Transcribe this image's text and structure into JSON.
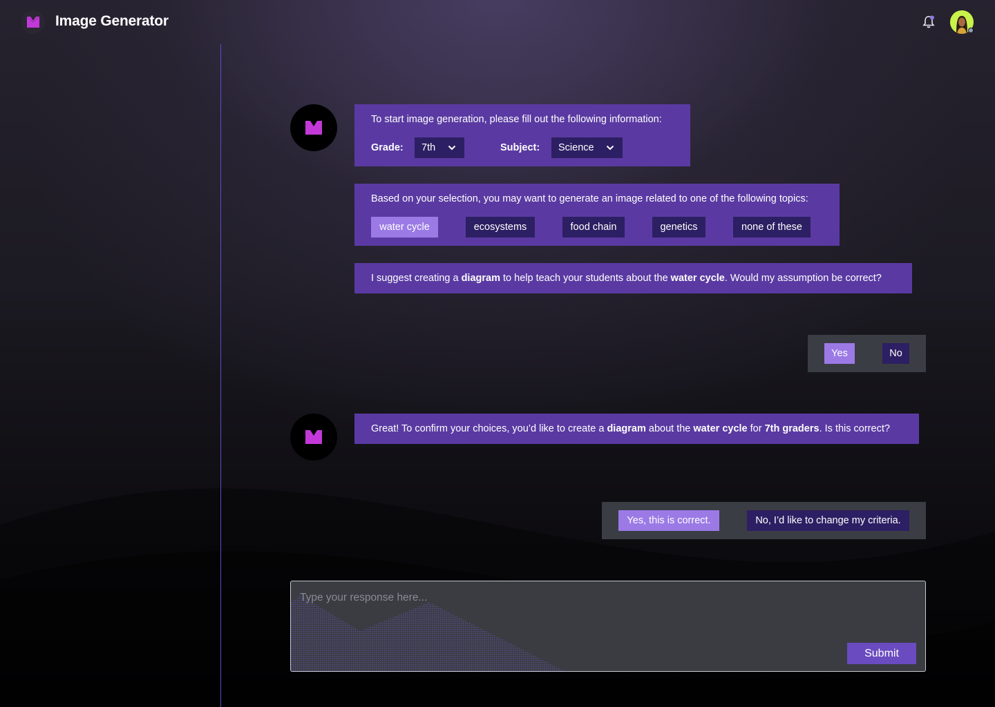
{
  "header": {
    "app_title": "Image Generator",
    "logo_icon": "m-logo-icon",
    "notification_icon": "bell-icon",
    "avatar": "user-avatar"
  },
  "colors": {
    "accent": "#5a3aa2",
    "chip_dark": "#2d1f63",
    "chip_active": "#9b7ae6",
    "brand_magenta": "#c339d8",
    "panel": "#3b3d44"
  },
  "chat": {
    "msg1": {
      "prompt": "To start image generation, please fill out the following information:",
      "grade_label": "Grade:",
      "grade_value": "7th",
      "subject_label": "Subject:",
      "subject_value": "Science"
    },
    "msg2": {
      "prompt": "Based on your selection, you may want to generate an image related to one of the following topics:",
      "topics": [
        "water cycle",
        "ecosystems",
        "food chain",
        "genetics",
        "none of these"
      ],
      "selected_topic": "water cycle"
    },
    "msg3": {
      "p1": "I suggest creating a ",
      "b1": "diagram",
      "p2": " to help teach your students about the ",
      "b2": "water cycle",
      "p3": ". Would my assumption be correct?"
    },
    "reply1": {
      "yes": "Yes",
      "no": "No"
    },
    "msg4": {
      "p1": "Great! To confirm your choices, you’d like to create a ",
      "b1": "diagram",
      "p2": " about the ",
      "b2": "water cycle",
      "p3": " for ",
      "b3": "7th graders",
      "p4": ". Is this correct?"
    },
    "reply2": {
      "yes": "Yes, this is correct.",
      "no": "No, I’d like to change my criteria."
    }
  },
  "composer": {
    "placeholder": "Type your response here...",
    "value": "",
    "submit_label": "Submit"
  }
}
